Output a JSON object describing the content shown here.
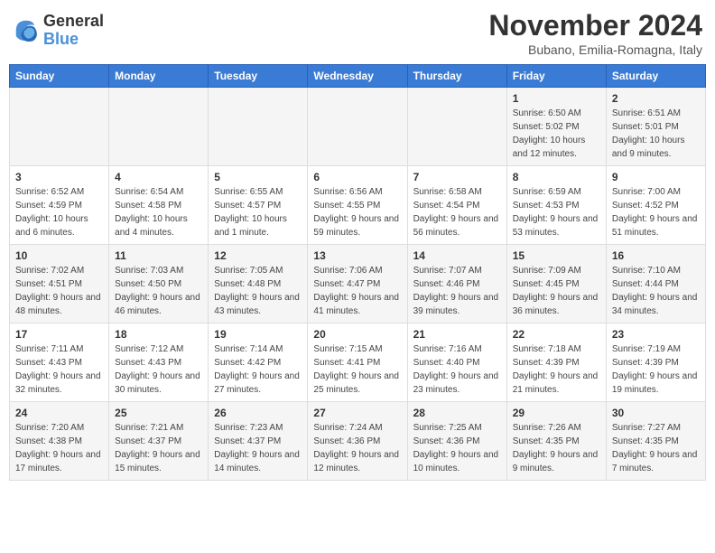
{
  "header": {
    "logo_line1": "General",
    "logo_line2": "Blue",
    "month": "November 2024",
    "location": "Bubano, Emilia-Romagna, Italy"
  },
  "days_of_week": [
    "Sunday",
    "Monday",
    "Tuesday",
    "Wednesday",
    "Thursday",
    "Friday",
    "Saturday"
  ],
  "weeks": [
    [
      {
        "day": "",
        "info": ""
      },
      {
        "day": "",
        "info": ""
      },
      {
        "day": "",
        "info": ""
      },
      {
        "day": "",
        "info": ""
      },
      {
        "day": "",
        "info": ""
      },
      {
        "day": "1",
        "info": "Sunrise: 6:50 AM\nSunset: 5:02 PM\nDaylight: 10 hours and 12 minutes."
      },
      {
        "day": "2",
        "info": "Sunrise: 6:51 AM\nSunset: 5:01 PM\nDaylight: 10 hours and 9 minutes."
      }
    ],
    [
      {
        "day": "3",
        "info": "Sunrise: 6:52 AM\nSunset: 4:59 PM\nDaylight: 10 hours and 6 minutes."
      },
      {
        "day": "4",
        "info": "Sunrise: 6:54 AM\nSunset: 4:58 PM\nDaylight: 10 hours and 4 minutes."
      },
      {
        "day": "5",
        "info": "Sunrise: 6:55 AM\nSunset: 4:57 PM\nDaylight: 10 hours and 1 minute."
      },
      {
        "day": "6",
        "info": "Sunrise: 6:56 AM\nSunset: 4:55 PM\nDaylight: 9 hours and 59 minutes."
      },
      {
        "day": "7",
        "info": "Sunrise: 6:58 AM\nSunset: 4:54 PM\nDaylight: 9 hours and 56 minutes."
      },
      {
        "day": "8",
        "info": "Sunrise: 6:59 AM\nSunset: 4:53 PM\nDaylight: 9 hours and 53 minutes."
      },
      {
        "day": "9",
        "info": "Sunrise: 7:00 AM\nSunset: 4:52 PM\nDaylight: 9 hours and 51 minutes."
      }
    ],
    [
      {
        "day": "10",
        "info": "Sunrise: 7:02 AM\nSunset: 4:51 PM\nDaylight: 9 hours and 48 minutes."
      },
      {
        "day": "11",
        "info": "Sunrise: 7:03 AM\nSunset: 4:50 PM\nDaylight: 9 hours and 46 minutes."
      },
      {
        "day": "12",
        "info": "Sunrise: 7:05 AM\nSunset: 4:48 PM\nDaylight: 9 hours and 43 minutes."
      },
      {
        "day": "13",
        "info": "Sunrise: 7:06 AM\nSunset: 4:47 PM\nDaylight: 9 hours and 41 minutes."
      },
      {
        "day": "14",
        "info": "Sunrise: 7:07 AM\nSunset: 4:46 PM\nDaylight: 9 hours and 39 minutes."
      },
      {
        "day": "15",
        "info": "Sunrise: 7:09 AM\nSunset: 4:45 PM\nDaylight: 9 hours and 36 minutes."
      },
      {
        "day": "16",
        "info": "Sunrise: 7:10 AM\nSunset: 4:44 PM\nDaylight: 9 hours and 34 minutes."
      }
    ],
    [
      {
        "day": "17",
        "info": "Sunrise: 7:11 AM\nSunset: 4:43 PM\nDaylight: 9 hours and 32 minutes."
      },
      {
        "day": "18",
        "info": "Sunrise: 7:12 AM\nSunset: 4:43 PM\nDaylight: 9 hours and 30 minutes."
      },
      {
        "day": "19",
        "info": "Sunrise: 7:14 AM\nSunset: 4:42 PM\nDaylight: 9 hours and 27 minutes."
      },
      {
        "day": "20",
        "info": "Sunrise: 7:15 AM\nSunset: 4:41 PM\nDaylight: 9 hours and 25 minutes."
      },
      {
        "day": "21",
        "info": "Sunrise: 7:16 AM\nSunset: 4:40 PM\nDaylight: 9 hours and 23 minutes."
      },
      {
        "day": "22",
        "info": "Sunrise: 7:18 AM\nSunset: 4:39 PM\nDaylight: 9 hours and 21 minutes."
      },
      {
        "day": "23",
        "info": "Sunrise: 7:19 AM\nSunset: 4:39 PM\nDaylight: 9 hours and 19 minutes."
      }
    ],
    [
      {
        "day": "24",
        "info": "Sunrise: 7:20 AM\nSunset: 4:38 PM\nDaylight: 9 hours and 17 minutes."
      },
      {
        "day": "25",
        "info": "Sunrise: 7:21 AM\nSunset: 4:37 PM\nDaylight: 9 hours and 15 minutes."
      },
      {
        "day": "26",
        "info": "Sunrise: 7:23 AM\nSunset: 4:37 PM\nDaylight: 9 hours and 14 minutes."
      },
      {
        "day": "27",
        "info": "Sunrise: 7:24 AM\nSunset: 4:36 PM\nDaylight: 9 hours and 12 minutes."
      },
      {
        "day": "28",
        "info": "Sunrise: 7:25 AM\nSunset: 4:36 PM\nDaylight: 9 hours and 10 minutes."
      },
      {
        "day": "29",
        "info": "Sunrise: 7:26 AM\nSunset: 4:35 PM\nDaylight: 9 hours and 9 minutes."
      },
      {
        "day": "30",
        "info": "Sunrise: 7:27 AM\nSunset: 4:35 PM\nDaylight: 9 hours and 7 minutes."
      }
    ]
  ]
}
